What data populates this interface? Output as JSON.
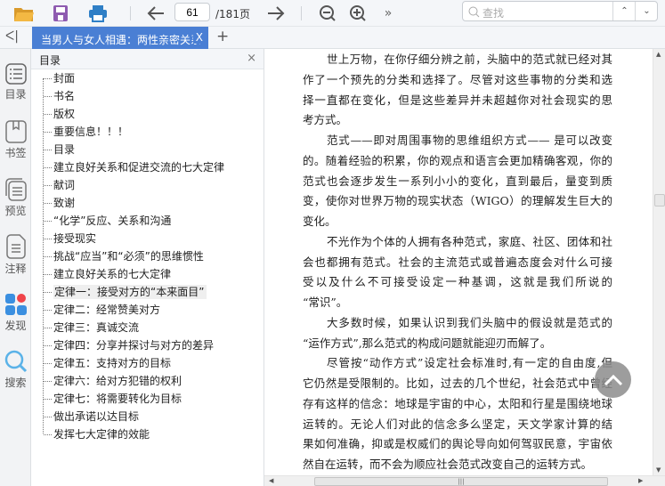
{
  "toolbar": {
    "page_current": "61",
    "page_total": "/181页",
    "search_placeholder": "查找",
    "more": "»"
  },
  "tab": {
    "title": "当男人与女人相遇：两性亲密关系",
    "close": "X",
    "add": "+",
    "collapse": "ᐸ|"
  },
  "rail": [
    {
      "label": "目录",
      "icon": "toc-icon"
    },
    {
      "label": "书签",
      "icon": "bookmark-icon"
    },
    {
      "label": "预览",
      "icon": "preview-icon"
    },
    {
      "label": "注释",
      "icon": "note-icon"
    },
    {
      "label": "发现",
      "icon": "discover-icon"
    },
    {
      "label": "搜索",
      "icon": "search-icon"
    }
  ],
  "toc": {
    "title": "目录",
    "close": "×",
    "selected_index": 13,
    "items": [
      "封面",
      "书名",
      "版权",
      "重要信息！！！",
      "目录",
      "建立良好关系和促进交流的七大定律",
      "献词",
      "致谢",
      "“化学”反应、关系和沟通",
      "接受现实",
      "挑战“应当”和“必须”的思维惯性",
      "建立良好关系的七大定律",
      "定律一：接受对方的“本来面目”",
      "定律二：经常赞美对方",
      "定律三：真诚交流",
      "定律四：分享并探讨与对方的差异",
      "定律五：支持对方的目标",
      "定律六：给对方犯错的权利",
      "定律七：将需要转化为目标",
      "做出承诺以达目标",
      "发挥七大定律的效能"
    ]
  },
  "content": {
    "paragraphs": [
      [
        "世上万物，在你仔细分辨之前，头脑中的范式就已经对其",
        "作了一个预先的分类和选择了。尽管对这些事物的分类和选",
        "择一直都在变化，但是这些差异并未超越你对社会现实的思",
        "考方式。"
      ],
      [
        "范式——即对周围事物的思维组织方式—— 是可以改变",
        "的。随着经验的积累，你的观点和语言会更加精确客观，你的",
        "范式也会逐步发生一系列小小的变化，直到最后，量变到质",
        "变，使你对世界万物的现实状态（WIGO）的理解发生巨大的",
        "变化。"
      ],
      [
        "不光作为个体的人拥有各种范式，家庭、社区、团体和社",
        "会也都拥有范式。社会的主流范式或普遍态度会对什么可接",
        "受以及什么不可接受设定一种基调，这就是我们所说的",
        "“常识”。"
      ],
      [
        "大多数时候，如果认识到我们头脑中的假设就是范式的",
        "“运作方式”,那么范式的构成问题就能迎刃而解了。"
      ],
      [
        "尽管按“动作方式”设定社会标准时,有一定的自由度,但",
        "它仍然是受限制的。比如，过去的几个世纪，社会范式中曾经",
        "存有这样的信念：地球是宇宙的中心，太阳和行星是围绕地球",
        "运转的。无论人们对此的信念多么坚定，天文学家计算的结",
        "果如何准确，抑或是权威们的舆论导向如何驾驭民意，宇宙依",
        "然自在运转，而不会为顺应社会范式改变自己的运转方式。"
      ]
    ]
  },
  "colors": {
    "accent": "#4a7fd4",
    "folder": "#f0b23a",
    "save": "#8e5bb0",
    "print": "#2f7fc6"
  }
}
